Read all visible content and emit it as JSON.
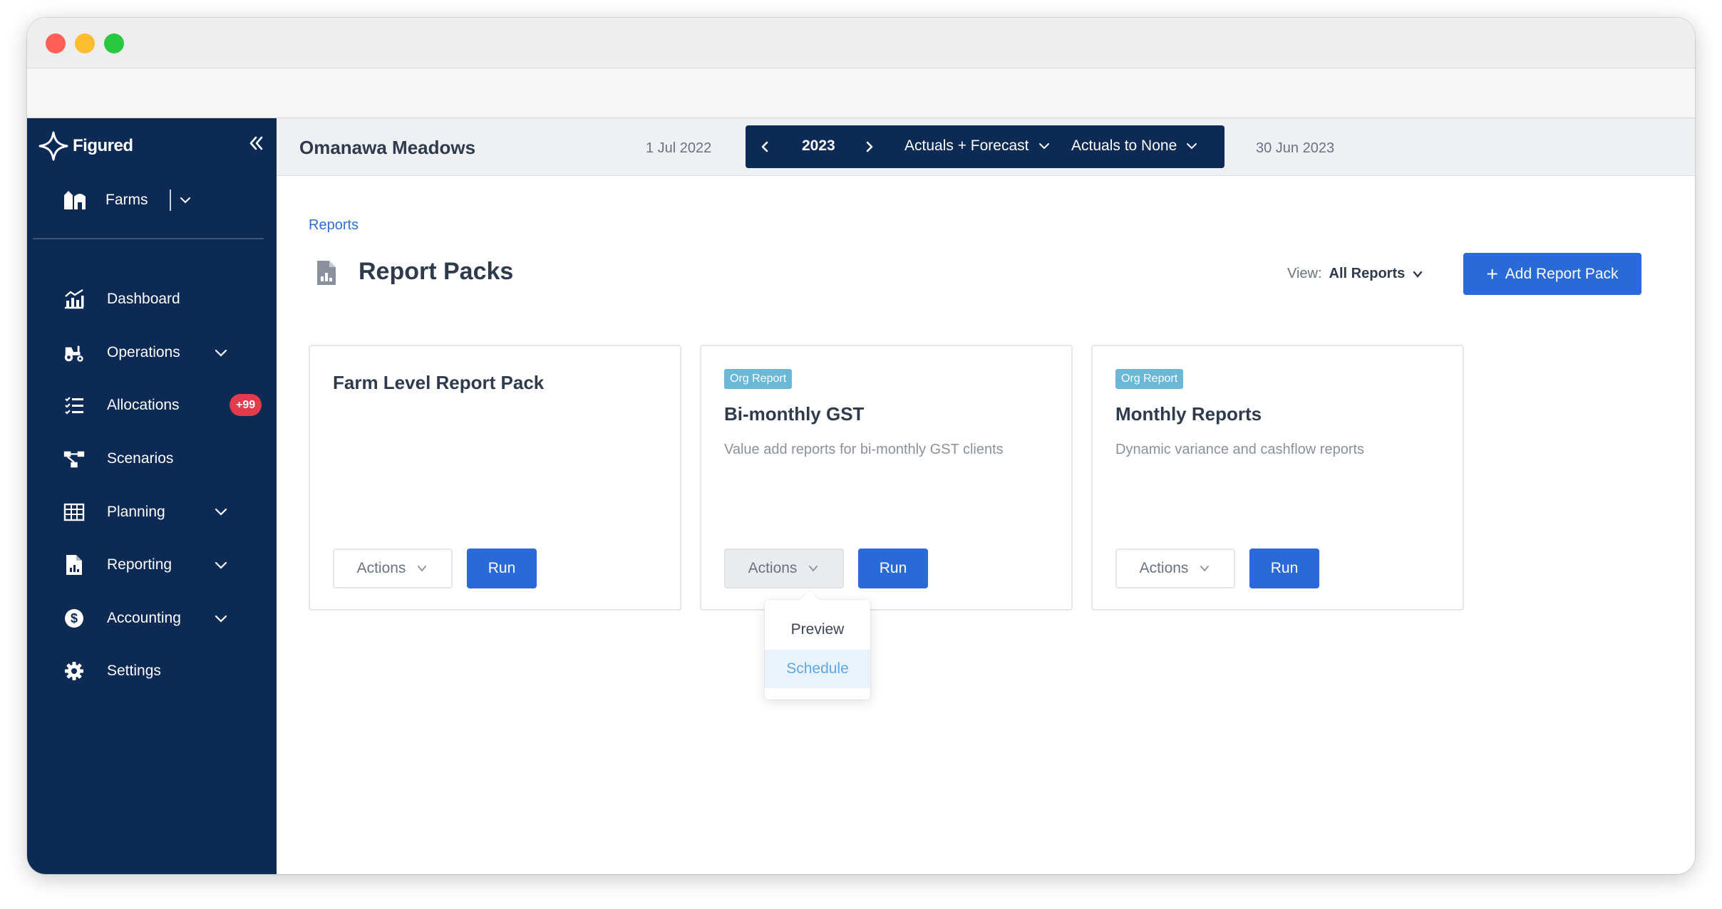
{
  "window": {
    "controls": [
      "close",
      "minimize",
      "zoom"
    ]
  },
  "sidebar": {
    "brand": "Figured",
    "farms_label": "Farms",
    "items": [
      {
        "label": "Dashboard",
        "icon": "dashboard-chart-icon",
        "has_chevron": false
      },
      {
        "label": "Operations",
        "icon": "tractor-icon",
        "has_chevron": true
      },
      {
        "label": "Allocations",
        "icon": "checklist-icon",
        "has_chevron": false,
        "badge": "+99"
      },
      {
        "label": "Scenarios",
        "icon": "scenarios-tree-icon",
        "has_chevron": false
      },
      {
        "label": "Planning",
        "icon": "table-grid-icon",
        "has_chevron": true
      },
      {
        "label": "Reporting",
        "icon": "report-document-icon",
        "has_chevron": true
      },
      {
        "label": "Accounting",
        "icon": "dollar-circle-icon",
        "has_chevron": true
      },
      {
        "label": "Settings",
        "icon": "gear-icon",
        "has_chevron": false
      }
    ],
    "colors": {
      "background": "#0d2a55",
      "badge": "#e23b4b"
    }
  },
  "topbar": {
    "farm_name": "Omanawa Meadows",
    "start_date": "1 Jul 2022",
    "end_date": "30 Jun 2023",
    "year": "2023",
    "mode": "Actuals + Forecast",
    "comparison": "Actuals to None"
  },
  "main": {
    "breadcrumb": "Reports",
    "title": "Report Packs",
    "view_label": "View:",
    "view_value": "All Reports",
    "add_button": "Add Report Pack",
    "accent": "#2a6ad8"
  },
  "cards": [
    {
      "title": "Farm Level Report Pack",
      "tag": "",
      "description": "",
      "actions_label": "Actions",
      "run_label": "Run"
    },
    {
      "title": "Bi-monthly GST",
      "tag": "Org Report",
      "description": "Value add reports for bi-monthly GST clients",
      "actions_label": "Actions",
      "run_label": "Run"
    },
    {
      "title": "Monthly Reports",
      "tag": "Org Report",
      "description": "Dynamic variance and cashflow reports",
      "actions_label": "Actions",
      "run_label": "Run"
    }
  ],
  "actions_menu": {
    "items": [
      "Preview",
      "Schedule"
    ],
    "highlighted": "Schedule"
  }
}
